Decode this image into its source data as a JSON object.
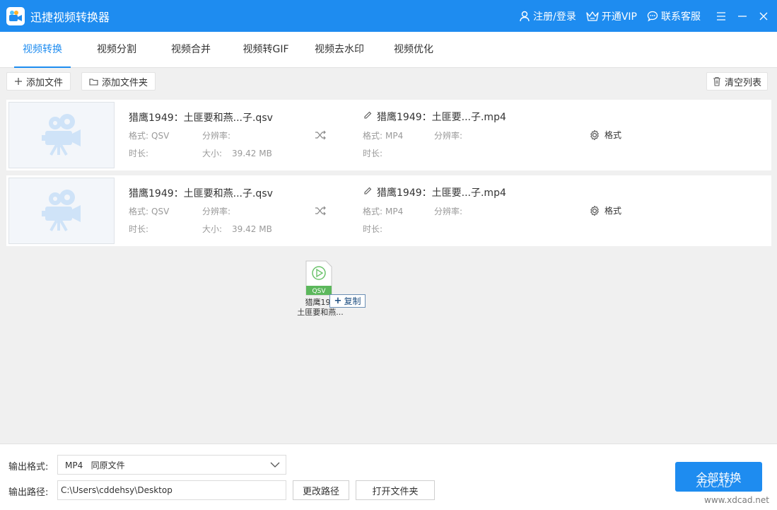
{
  "window": {
    "title": "迅捷视频转换器",
    "header_links": [
      {
        "label": "注册/登录",
        "icon": "user-icon"
      },
      {
        "label": "开通VIP",
        "icon": "crown-icon"
      },
      {
        "label": "联系客服",
        "icon": "chat-icon"
      }
    ]
  },
  "tabs": [
    {
      "label": "视频转换",
      "active": true
    },
    {
      "label": "视频分割"
    },
    {
      "label": "视频合并"
    },
    {
      "label": "视频转GIF"
    },
    {
      "label": "视频去水印"
    },
    {
      "label": "视频优化"
    }
  ],
  "toolbar": {
    "add_file": "添加文件",
    "add_folder": "添加文件夹",
    "clear_list": "清空列表"
  },
  "files": [
    {
      "source_name": "猎鹰1949：土匪要和燕...子.qsv",
      "source_format_label": "格式:",
      "source_format": "QSV",
      "resolution_label": "分辨率:",
      "duration_label": "时长:",
      "size_label": "大小:",
      "size": "39.42 MB",
      "target_name": "猎鹰1949：土匪要...子.mp4",
      "target_format_label": "格式:",
      "target_format": "MP4",
      "target_resolution_label": "分辨率:",
      "target_duration_label": "时长:",
      "format_button": "格式"
    },
    {
      "source_name": "猎鹰1949：土匪要和燕...子.qsv",
      "source_format_label": "格式:",
      "source_format": "QSV",
      "resolution_label": "分辨率:",
      "duration_label": "时长:",
      "size_label": "大小:",
      "size": "39.42 MB",
      "target_name": "猎鹰1949：土匪要...子.mp4",
      "target_format_label": "格式:",
      "target_format": "MP4",
      "target_resolution_label": "分辨率:",
      "target_duration_label": "时长:",
      "format_button": "格式"
    }
  ],
  "drag": {
    "file_badge": "QSV",
    "label_line1": "猎鹰194",
    "label_line2": "土匪要和燕...",
    "copy_tip": "复制"
  },
  "bottom": {
    "output_format_label": "输出格式:",
    "output_format_value": "MP4   同原文件",
    "output_path_label": "输出路径:",
    "output_path_value": "C:\\Users\\cddehsy\\Desktop",
    "change_path": "更改路径",
    "open_folder": "打开文件夹",
    "convert_all": "全部转换"
  },
  "watermark": {
    "line1": "XDCAD",
    "line2": "www.xdcad.net"
  },
  "colors": {
    "accent": "#1e8cf0",
    "muted": "#9a9a9a"
  }
}
